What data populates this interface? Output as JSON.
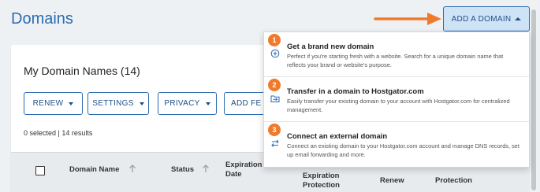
{
  "page": {
    "title": "Domains"
  },
  "add_domain": {
    "label": "ADD A DOMAIN"
  },
  "card": {
    "title": "My Domain Names (14)",
    "toolbar": {
      "renew": "RENEW",
      "settings": "SETTINGS",
      "privacy": "PRIVACY",
      "add_features": "ADD FE"
    },
    "results_text": "0 selected | 14 results"
  },
  "table": {
    "headers": {
      "domain_name": "Domain Name",
      "status": "Status",
      "expiration_date_1": "Expiration",
      "expiration_date_2": "Date",
      "expiration_protection_1": "Expiration",
      "expiration_protection_2": "Protection",
      "renew": "Renew",
      "protection": "Protection"
    }
  },
  "dropdown": {
    "items": [
      {
        "number": "1",
        "icon": "plus-circle-icon",
        "title": "Get a brand new domain",
        "description": "Perfect if you're starting fresh with a website. Search for a unique domain name that reflects your brand or website's purpose."
      },
      {
        "number": "2",
        "icon": "folder-transfer-icon",
        "title": "Transfer in a domain to Hostgator.com",
        "description": "Easily transfer your existing domain to your account with Hostgator.com for centralized management."
      },
      {
        "number": "3",
        "icon": "swap-arrows-icon",
        "title": "Connect an external domain",
        "description": "Connect an existing domain to your Hostgator.com account and manage DNS records, set up email forwarding and more."
      }
    ]
  },
  "colors": {
    "accent": "#2a6bb3",
    "badge": "#f07a2c",
    "arrow": "#f07a2c"
  }
}
